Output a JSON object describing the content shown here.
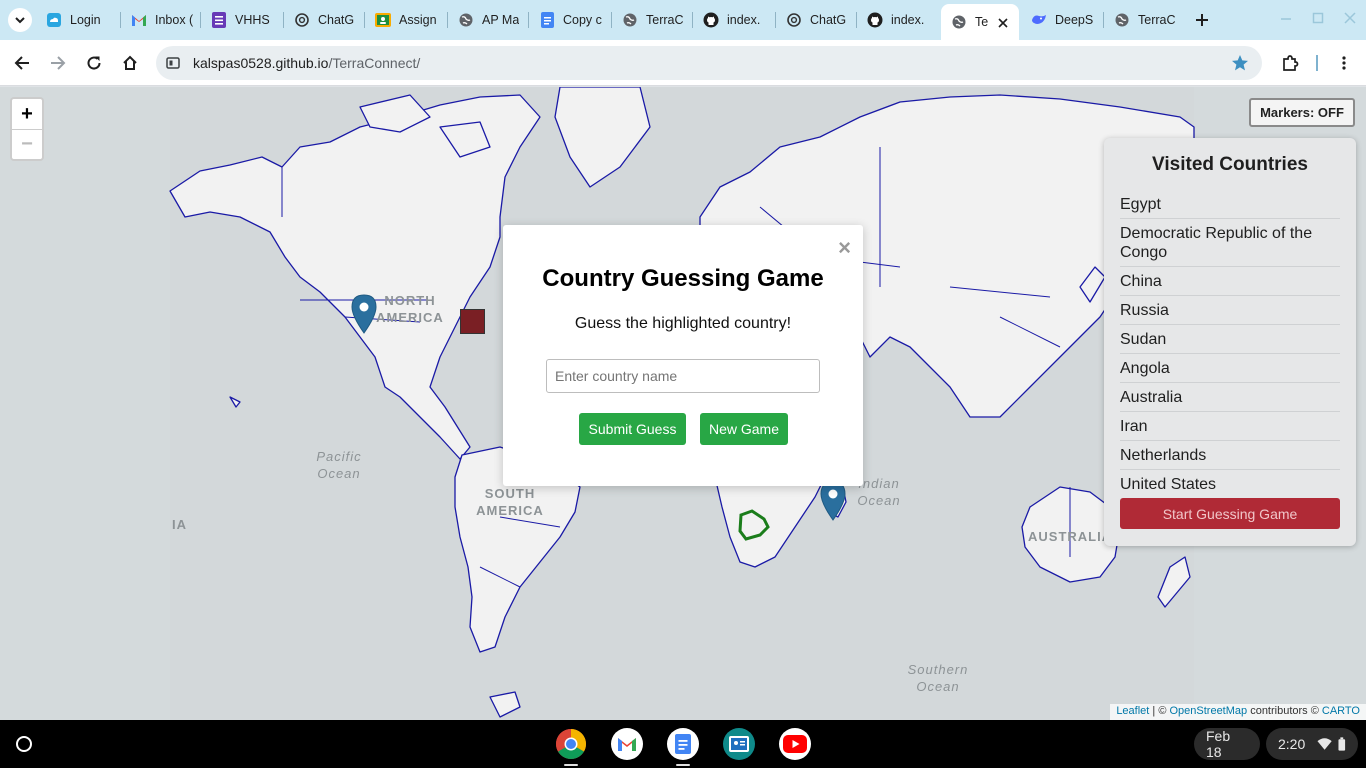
{
  "browser": {
    "tabs": [
      {
        "label": "Login",
        "icon": "cloud-icon"
      },
      {
        "label": "Inbox (",
        "icon": "gmail-icon"
      },
      {
        "label": "VHHS",
        "icon": "forms-icon"
      },
      {
        "label": "ChatG",
        "icon": "chatgpt-icon"
      },
      {
        "label": "Assign",
        "icon": "classroom-icon"
      },
      {
        "label": "AP Ma",
        "icon": "globe-icon"
      },
      {
        "label": "Copy c",
        "icon": "docs-icon"
      },
      {
        "label": "TerraC",
        "icon": "globe-icon"
      },
      {
        "label": "index.",
        "icon": "github-icon"
      },
      {
        "label": "ChatG",
        "icon": "chatgpt-icon"
      },
      {
        "label": "index.",
        "icon": "github-icon"
      },
      {
        "label": "Te",
        "icon": "globe-icon",
        "active": true
      },
      {
        "label": "DeepS",
        "icon": "deepseek-icon"
      },
      {
        "label": "TerraC",
        "icon": "globe-icon"
      }
    ],
    "url": {
      "host": "kalspas0528.github.io",
      "path": "/TerraConnect/"
    }
  },
  "map": {
    "labels": {
      "north_america": "NORTH AMERICA",
      "south_america": "SOUTH AMERICA",
      "australia": "AUSTRALIA",
      "asia_fragment": "IA",
      "pacific": "Pacific Ocean",
      "indian": "Indian Ocean",
      "southern": "Southern Ocean"
    },
    "zoom_in": "+",
    "zoom_out": "−",
    "markers_toggle": "Markers: OFF",
    "attribution": {
      "leaflet": "Leaflet",
      "sep": " | © ",
      "osm": "OpenStreetMap",
      "contrib": " contributors © ",
      "carto": "CARTO"
    }
  },
  "visited": {
    "title": "Visited Countries",
    "countries": [
      "Egypt",
      "Democratic Republic of the Congo",
      "China",
      "Russia",
      "Sudan",
      "Angola",
      "Australia",
      "Iran",
      "Netherlands",
      "United States"
    ],
    "start_button": "Start Guessing Game"
  },
  "modal": {
    "close": "×",
    "title": "Country Guessing Game",
    "subtitle": "Guess the highlighted country!",
    "input_placeholder": "Enter country name",
    "input_value": "",
    "submit_label": "Submit Guess",
    "newgame_label": "New Game"
  },
  "shelf": {
    "apps": [
      "chrome-icon",
      "gmail-icon",
      "docs-icon",
      "classroom-icon",
      "youtube-icon"
    ],
    "date": "Feb 18",
    "time": "2:20"
  },
  "colors": {
    "tabstrip": "#cce8f4",
    "border_lines": "#1a1aa6",
    "highlight": "#1b7d1b",
    "button_green": "#28a745",
    "button_red": "#b02a36",
    "marker": "#2a6f9e"
  }
}
